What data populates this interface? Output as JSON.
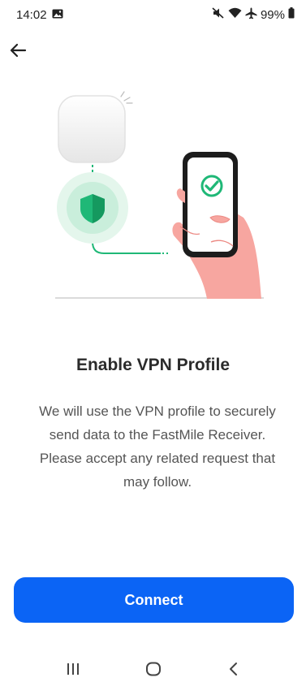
{
  "status_bar": {
    "time": "14:02",
    "battery": "99%",
    "icons": [
      "gallery-icon",
      "mute-icon",
      "wifi-icon",
      "airplane-icon",
      "battery-icon"
    ]
  },
  "header": {
    "back_icon": "arrow-left-icon"
  },
  "illustration": {
    "elements": [
      "receiver-device",
      "shield-icon",
      "phone-with-check",
      "hand"
    ],
    "colors": {
      "accent_green": "#1fb877",
      "shield_halo": "#e4f6ec",
      "hand": "#f7a6a0"
    }
  },
  "content": {
    "title": "Enable VPN Profile",
    "description": "We will use the VPN profile to securely send data to the FastMile Receiver. Please accept any related request that may follow."
  },
  "actions": {
    "connect_label": "Connect",
    "connect_color": "#0b64f5"
  },
  "nav_bar": {
    "icons": [
      "recent-apps-icon",
      "home-icon",
      "back-icon"
    ]
  }
}
